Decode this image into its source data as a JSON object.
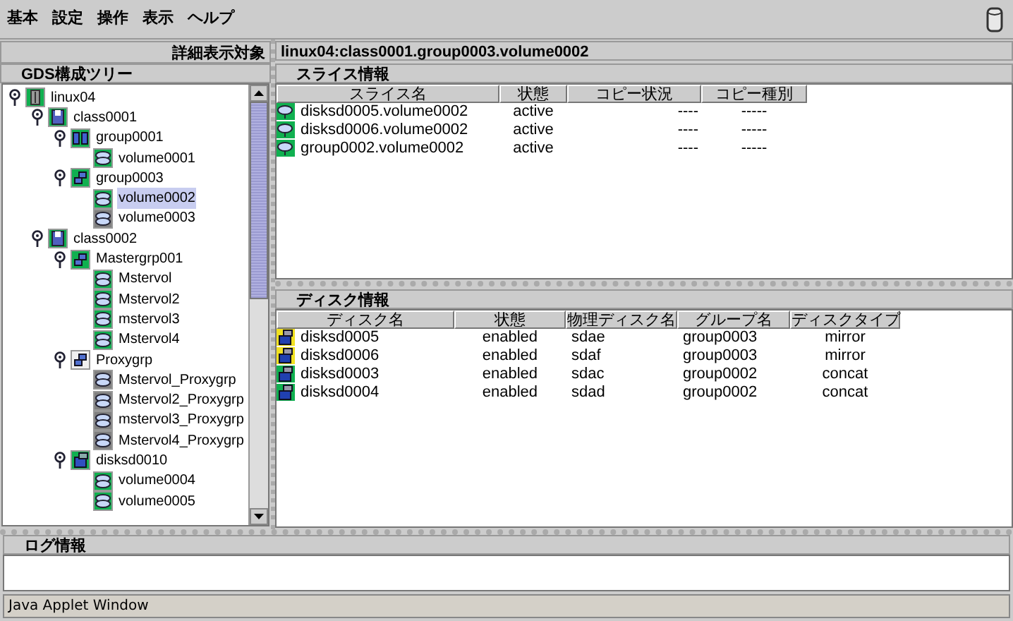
{
  "menu": [
    "基本",
    "設定",
    "操作",
    "表示",
    "ヘルプ"
  ],
  "detail_label": "詳細表示対象",
  "detail_path": "linux04:class0001.group0003.volume0002",
  "tree": {
    "title": "GDS構成ツリー",
    "nodes": [
      {
        "label": "linux04",
        "kind": "host",
        "color": "#10b050",
        "selected": false,
        "expanded": true,
        "children": [
          {
            "label": "class0001",
            "kind": "class",
            "color": "#10b050",
            "selected": false,
            "expanded": true,
            "children": [
              {
                "label": "group0001",
                "kind": "mirror",
                "color": "#10b050",
                "selected": false,
                "expanded": true,
                "children": [
                  {
                    "label": "volume0001",
                    "kind": "volume",
                    "color": "#10b050",
                    "selected": false
                  }
                ]
              },
              {
                "label": "group0003",
                "kind": "group",
                "color": "#10b050",
                "selected": false,
                "expanded": true,
                "children": [
                  {
                    "label": "volume0002",
                    "kind": "volume",
                    "color": "#10b050",
                    "selected": true
                  },
                  {
                    "label": "volume0003",
                    "kind": "volume",
                    "color": "#808080",
                    "selected": false
                  }
                ]
              }
            ]
          },
          {
            "label": "class0002",
            "kind": "class",
            "color": "#10b050",
            "selected": false,
            "expanded": true,
            "children": [
              {
                "label": "Mastergrp001",
                "kind": "group",
                "color": "#10b050",
                "selected": false,
                "expanded": true,
                "children": [
                  {
                    "label": "Mstervol",
                    "kind": "volume",
                    "color": "#10b050",
                    "selected": false
                  },
                  {
                    "label": "Mstervol2",
                    "kind": "volume",
                    "color": "#10b050",
                    "selected": false
                  },
                  {
                    "label": "mstervol3",
                    "kind": "volume",
                    "color": "#10b050",
                    "selected": false
                  },
                  {
                    "label": "Mstervol4",
                    "kind": "volume",
                    "color": "#10b050",
                    "selected": false
                  }
                ]
              },
              {
                "label": "Proxygrp",
                "kind": "group",
                "color": "#f0f0f0",
                "selected": false,
                "expanded": true,
                "children": [
                  {
                    "label": "Mstervol_Proxygrp",
                    "kind": "volume",
                    "color": "#808080",
                    "selected": false
                  },
                  {
                    "label": "Mstervol2_Proxygrp",
                    "kind": "volume",
                    "color": "#808080",
                    "selected": false
                  },
                  {
                    "label": "mstervol3_Proxygrp",
                    "kind": "volume",
                    "color": "#808080",
                    "selected": false
                  },
                  {
                    "label": "Mstervol4_Proxygrp",
                    "kind": "volume",
                    "color": "#808080",
                    "selected": false
                  }
                ]
              },
              {
                "label": "disksd0010",
                "kind": "disk",
                "color": "#10b050",
                "selected": false,
                "expanded": true,
                "children": [
                  {
                    "label": "volume0004",
                    "kind": "volume",
                    "color": "#10b050",
                    "selected": false
                  },
                  {
                    "label": "volume0005",
                    "kind": "volume",
                    "color": "#10b050",
                    "selected": false
                  }
                ]
              }
            ]
          }
        ]
      }
    ]
  },
  "slice_info": {
    "title": "スライス情報",
    "columns": [
      "スライス名",
      "状態",
      "コピー状況",
      "コピー種別"
    ],
    "rows": [
      {
        "color": "#10b050",
        "cells": [
          "disksd0005.volume0002",
          "active",
          "----",
          "-----"
        ]
      },
      {
        "color": "#10b050",
        "cells": [
          "disksd0006.volume0002",
          "active",
          "----",
          "-----"
        ]
      },
      {
        "color": "#10b050",
        "cells": [
          "group0002.volume0002",
          "active",
          "----",
          "-----"
        ]
      }
    ]
  },
  "disk_info": {
    "title": "ディスク情報",
    "columns": [
      "ディスク名",
      "状態",
      "物理ディスク名",
      "グループ名",
      "ディスクタイプ"
    ],
    "rows": [
      {
        "color": "#f0e020",
        "cells": [
          "disksd0005",
          "enabled",
          "sdae",
          "group0003",
          "mirror"
        ]
      },
      {
        "color": "#f0e020",
        "cells": [
          "disksd0006",
          "enabled",
          "sdaf",
          "group0003",
          "mirror"
        ]
      },
      {
        "color": "#10b050",
        "cells": [
          "disksd0003",
          "enabled",
          "sdac",
          "group0002",
          "concat"
        ]
      },
      {
        "color": "#10b050",
        "cells": [
          "disksd0004",
          "enabled",
          "sdad",
          "group0002",
          "concat"
        ]
      }
    ]
  },
  "log": {
    "title": "ログ情報"
  },
  "status_bar": "Java Applet Window"
}
